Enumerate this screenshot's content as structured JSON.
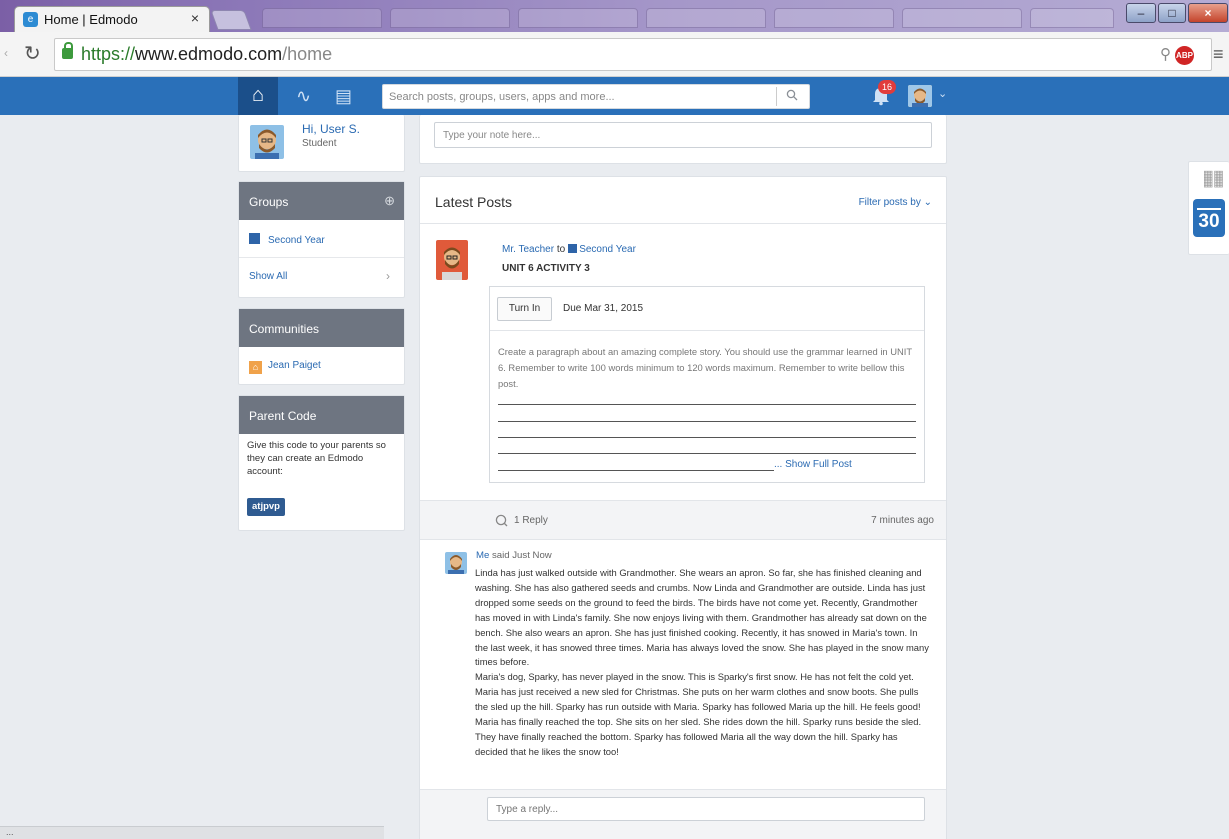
{
  "browser": {
    "tab_title": "Home | Edmodo",
    "tab_close": "×",
    "url_scheme": "https://",
    "url_host": "www.edmodo.com",
    "url_path": "/home",
    "favicon": "edmodo-favicon-icon"
  },
  "nav": {
    "search_placeholder": "Search posts, groups, users, apps and more...",
    "notification_count": "16",
    "accent": "#2a70b9"
  },
  "profile": {
    "greeting": "Hi, User S.",
    "role": "Student"
  },
  "groups": {
    "title": "Groups",
    "items": [
      {
        "label": "Second Year",
        "color": "#2e64a8"
      }
    ],
    "show_all": "Show All"
  },
  "communities": {
    "title": "Communities",
    "items": [
      {
        "label": "Jean Paiget"
      }
    ]
  },
  "parent_code": {
    "title": "Parent Code",
    "description": "Give this code to your parents so they can create an Edmodo account:",
    "code": "atjpvp"
  },
  "note": {
    "placeholder": "Type your note here..."
  },
  "feed": {
    "title": "Latest Posts",
    "filter_label": "Filter posts by"
  },
  "post": {
    "author": "Mr. Teacher",
    "to_word": "to",
    "group": "Second Year",
    "title": "UNIT 6 ACTIVITY 3",
    "turn_in": "Turn In",
    "due": "Due Mar 31, 2015",
    "body": "Create a paragraph about an amazing complete story. You should use the grammar learned in UNIT 6. Remember to write 100 words minimum to 120 words maximum. Remember to write bellow this post.",
    "show_full": "... Show Full Post",
    "reply_count": "1 Reply",
    "time": "7 minutes ago"
  },
  "reply": {
    "author": "Me",
    "said": "said Just Now",
    "text": "Linda has just walked outside with Grandmother. She wears an apron. So far, she has finished cleaning and washing. She has also gathered seeds and crumbs. Now Linda and Grandmother are outside. Linda has just dropped some seeds on the ground to feed the birds. The birds have not come yet. Recently, Grandmother has moved in with Linda's family. She now enjoys living with them. Grandmother has already sat down on the bench. She also wears an apron. She has just finished cooking. Recently, it has snowed in Maria's town. In the last week, it has snowed three times. Maria has always loved the snow. She has played in the snow many times before.\nMaria's dog, Sparky, has never played in the snow. This is Sparky's first snow. He has not felt the cold yet. Maria has just received a new sled for Christmas. She puts on her warm clothes and snow boots. She pulls the sled up the hill. Sparky has run outside with Maria. Sparky has followed Maria up the hill. He feels good! Maria has finally reached the top. She sits on her sled. She rides down the hill. Sparky runs beside the sled. They have finally reached the bottom. Sparky has followed Maria all the way down the hill. Sparky has decided that he likes the snow too!",
    "reply_placeholder": "Type a reply..."
  },
  "widgets": {
    "calendar_day": "30"
  },
  "status_bar": {
    "text": "..."
  }
}
